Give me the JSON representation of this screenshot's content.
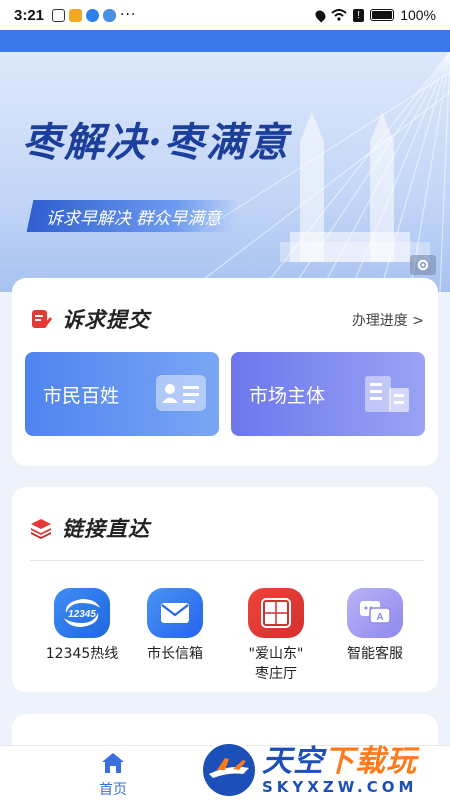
{
  "status_bar": {
    "time": "3:21",
    "battery": "100%",
    "left_icons": [
      "gallery-icon",
      "video-app-icon",
      "shield-app-icon",
      "cloud-icon",
      "more-dots"
    ],
    "right_icons": [
      "location-icon",
      "wifi-icon",
      "alert-icon",
      "battery-icon"
    ]
  },
  "banner": {
    "title": "枣解决·枣满意",
    "subtitle": "诉求早解决  群众早满意"
  },
  "submit_section": {
    "title": "诉求提交",
    "progress_link": "办理进度 >",
    "tiles": [
      {
        "label": "市民百姓",
        "icon": "id-card-icon",
        "color": "#4f84ef"
      },
      {
        "label": "市场主体",
        "icon": "office-building-icon",
        "color": "#6c77ec"
      }
    ]
  },
  "links_section": {
    "title": "链接直达",
    "shortcuts": [
      {
        "label": "12345热线",
        "icon_text": "12345",
        "icon": "hotline-12345-icon"
      },
      {
        "label": "市长信箱",
        "icon": "mailbox-icon"
      },
      {
        "label": "\"爱山东\"",
        "label2": "枣庄厅",
        "icon": "seal-icon"
      },
      {
        "label": "智能客服",
        "icon": "chat-bot-icon"
      }
    ]
  },
  "tabbar": {
    "home_label": "首页"
  },
  "watermark": {
    "main_1": "天空",
    "main_2": "下载玩",
    "sub": "SKYXZW.COM"
  },
  "colors": {
    "accent": "#3b78e7",
    "red_accent": "#e53935",
    "brand_blue": "#1d4fb8"
  }
}
